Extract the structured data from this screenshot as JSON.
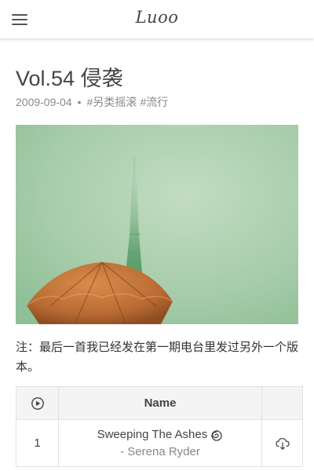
{
  "header": {
    "logo": "Luoo",
    "menu_icon": "hamburger-menu-icon"
  },
  "article": {
    "title": "Vol.54 侵袭",
    "date": "2009-09-04",
    "separator": "•",
    "tags": [
      "#另类摇滚",
      "#流行"
    ],
    "cover_alt_icon": "cover-image",
    "note": "注：最后一首我已经发在第一期电台里发过另外一个版本。"
  },
  "tracklist": {
    "header_play_icon": "play-circle-icon",
    "header_name": "Name",
    "rows": [
      {
        "num": "1",
        "name": "Sweeping The Ashes",
        "artist": "- Serena Ryder",
        "name_icon": "spiral-icon",
        "action_icon": "cloud-download-icon"
      }
    ]
  },
  "colors": {
    "fog_green": "#a3c9a5",
    "umbrella": "#c9783e",
    "border": "#e2e2e2"
  }
}
